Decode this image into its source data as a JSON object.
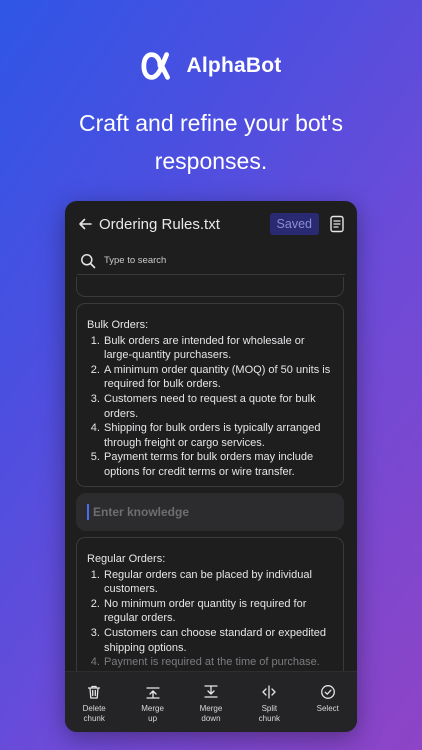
{
  "brand": {
    "name": "AlphaBot"
  },
  "tagline": "Craft and refine your bot's responses.",
  "editor": {
    "title": "Ordering Rules.txt",
    "saved_label": "Saved",
    "search_placeholder": "Type to search",
    "enter_placeholder": "Enter knowledge"
  },
  "chunks": {
    "bulk": {
      "heading": "Bulk Orders:",
      "items": [
        "Bulk orders are intended for wholesale or large-quantity purchasers.",
        "A minimum order quantity (MOQ) of 50 units is required for bulk orders.",
        "Customers need to request a quote for bulk orders.",
        "Shipping for bulk orders is typically arranged through freight or cargo services.",
        "Payment terms for bulk orders may include options for credit terms or wire transfer."
      ]
    },
    "regular": {
      "heading": "Regular Orders:",
      "items": [
        "Regular orders can be placed by individual customers.",
        "No minimum order quantity is required for regular orders.",
        "Customers can choose standard or expedited shipping options.",
        "Payment is required at the time of purchase."
      ]
    }
  },
  "toolbar": {
    "delete": "Delete\nchunk",
    "merge_up": "Merge\nup",
    "merge_down": "Merge\ndown",
    "split": "Split\nchunk",
    "select": "Select"
  }
}
